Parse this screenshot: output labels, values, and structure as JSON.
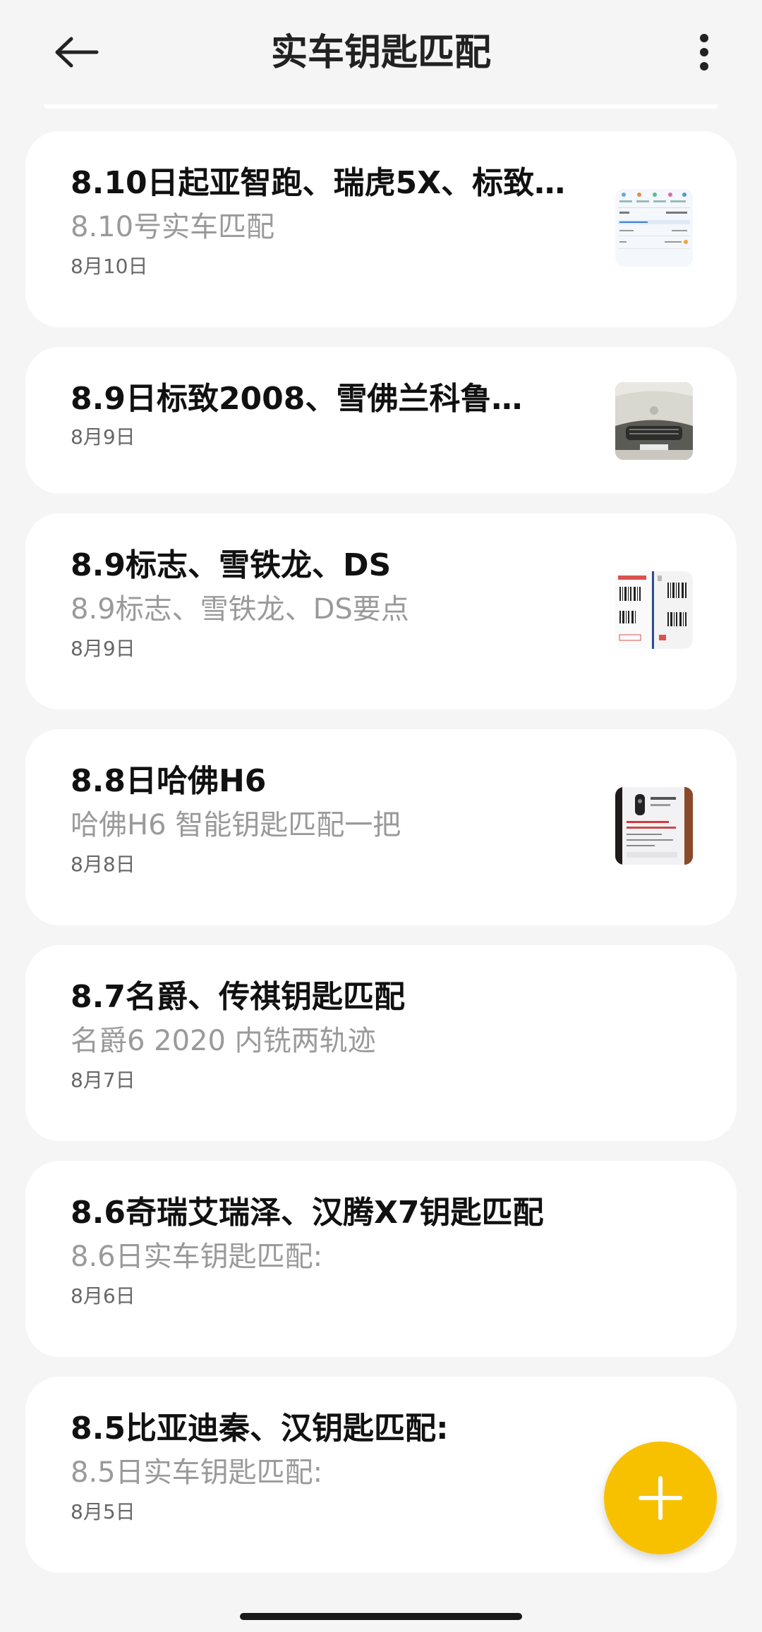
{
  "header": {
    "title": "实车钥匙匹配",
    "back_icon": "arrow-left-icon",
    "more_icon": "more-vertical-icon"
  },
  "notes": [
    {
      "title": "8.10日起亚智跑、瑞虎5X、标致…",
      "preview": "8.10号实车匹配",
      "date": "8月10日",
      "thumbnail": "app-screenshot-thumbnail"
    },
    {
      "title": "8.9日标致2008、雪佛兰科鲁…",
      "preview": "",
      "date": "8月9日",
      "thumbnail": "car-front-photo-thumbnail"
    },
    {
      "title": "8.9标志、雪铁龙、DS",
      "preview": "8.9标志、雪铁龙、DS要点",
      "date": "8月9日",
      "thumbnail": "barcode-labels-thumbnail"
    },
    {
      "title": "8.8日哈佛H6",
      "preview": "哈佛H6 智能钥匙匹配一把",
      "date": "8月8日",
      "thumbnail": "phone-screen-thumbnail"
    },
    {
      "title": "8.7名爵、传祺钥匙匹配",
      "preview": "名爵6 2020 内铣两轨迹",
      "date": "8月7日"
    },
    {
      "title": "8.6奇瑞艾瑞泽、汉腾X7钥匙匹配",
      "preview": "8.6日实车钥匙匹配:",
      "date": "8月6日"
    },
    {
      "title": "8.5比亚迪秦、汉钥匙匹配:",
      "preview": "8.5日实车钥匙匹配:",
      "date": "8月5日"
    }
  ],
  "fab": {
    "icon": "plus-icon",
    "color": "#f7c100"
  },
  "colors": {
    "background": "#f5f5f5",
    "card": "#ffffff",
    "title_text": "#111111",
    "preview_text": "#9a9a9a",
    "accent": "#f7c100"
  }
}
